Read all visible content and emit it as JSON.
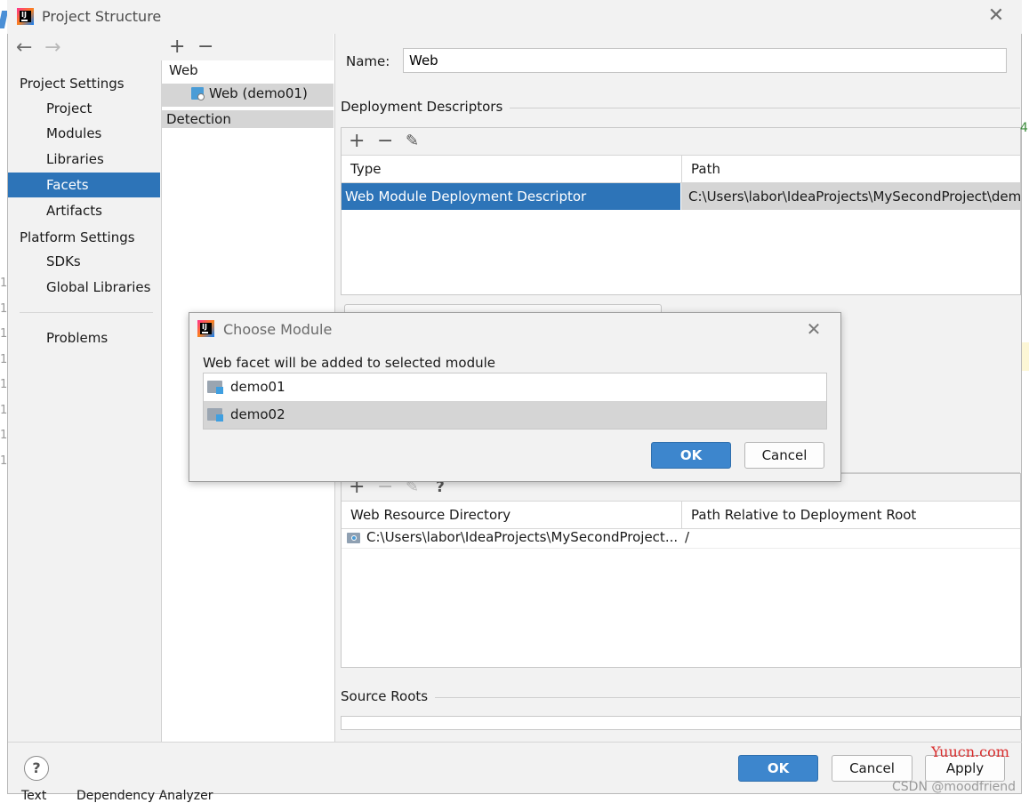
{
  "window": {
    "title": "Project Structure"
  },
  "sidebar": {
    "project_settings_header": "Project Settings",
    "platform_settings_header": "Platform Settings",
    "items": [
      {
        "label": "Project"
      },
      {
        "label": "Modules"
      },
      {
        "label": "Libraries"
      },
      {
        "label": "Facets",
        "selected": true
      },
      {
        "label": "Artifacts"
      },
      {
        "label": "SDKs"
      },
      {
        "label": "Global Libraries"
      },
      {
        "label": "Problems"
      }
    ]
  },
  "tree": {
    "toolbar": {
      "add": "+",
      "remove": "−"
    },
    "root": "Web",
    "child": "Web (demo01)",
    "detection": "Detection"
  },
  "facet": {
    "name_label": "Name:",
    "name_value": "Web",
    "deployment_descriptors": {
      "title": "Deployment Descriptors",
      "toolbar": {
        "add": "+",
        "remove": "−",
        "edit": "✎"
      },
      "columns": [
        "Type",
        "Path"
      ],
      "rows": [
        {
          "type": "Web Module Deployment Descriptor",
          "path": "C:\\Users\\labor\\IdeaProjects\\MySecondProject\\dem"
        }
      ]
    },
    "web_resource_directories": {
      "toolbar": {
        "add": "+",
        "remove": "−",
        "edit": "✎",
        "help": "?"
      },
      "columns": [
        "Web Resource Directory",
        "Path Relative to Deployment Root"
      ],
      "rows": [
        {
          "directory": "C:\\Users\\labor\\IdeaProjects\\MySecondProject...",
          "relative": "/"
        }
      ]
    },
    "source_roots": {
      "title": "Source Roots"
    }
  },
  "footer": {
    "help": "?",
    "ok": "OK",
    "cancel": "Cancel",
    "apply": "Apply"
  },
  "dialog": {
    "title": "Choose Module",
    "message": "Web facet will be added to selected module",
    "modules": [
      {
        "label": "demo01"
      },
      {
        "label": "demo02",
        "selected": true
      }
    ],
    "ok": "OK",
    "cancel": "Cancel"
  },
  "background": {
    "status_tabs": [
      "Text",
      "Dependency Analyzer"
    ],
    "fragment_right": "4",
    "line_numbers": [
      "1",
      "1",
      "1",
      "1",
      "1",
      "1",
      "1",
      "1"
    ]
  },
  "watermark": {
    "site": "Yuucn.com",
    "author": "CSDN @moodfriend"
  },
  "colors": {
    "accent": "#2d74b8",
    "selection_gray": "#d5d5d5",
    "primary_button": "#3d86cd"
  }
}
